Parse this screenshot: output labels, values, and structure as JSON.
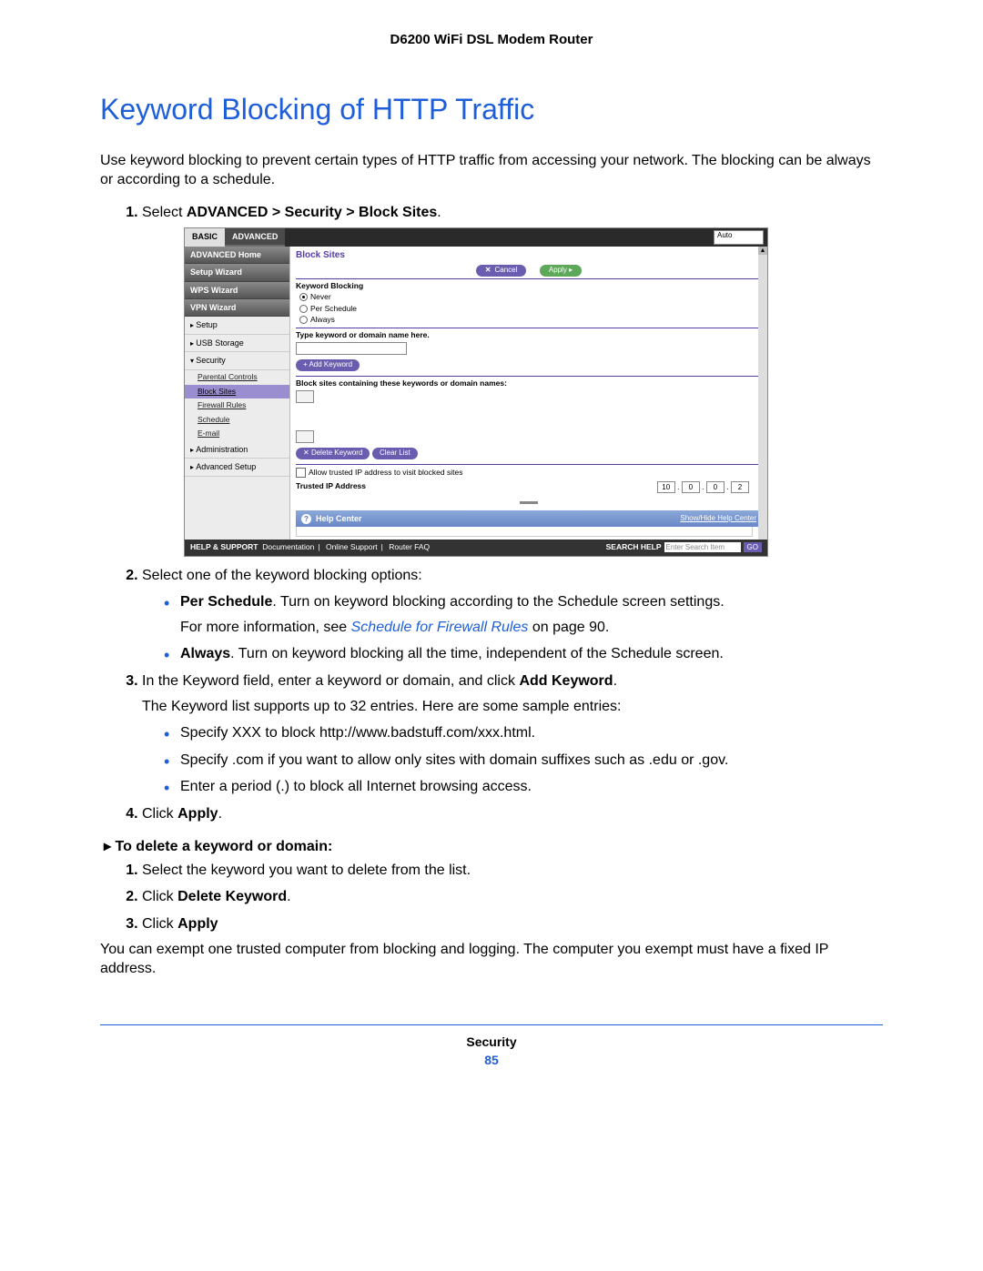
{
  "doc": {
    "header": "D6200 WiFi DSL Modem Router",
    "title": "Keyword Blocking of HTTP Traffic",
    "intro": "Use keyword blocking to prevent certain types of HTTP traffic from accessing your network. The blocking can be always or according to a schedule.",
    "step1_pre": "Select ",
    "step1_bold": "ADVANCED > Security > Block Sites",
    "step1_post": ".",
    "step2": "Select one of the keyword blocking options:",
    "opt1_label": "Per Schedule",
    "opt1_text": ". Turn on keyword blocking according to the Schedule screen settings.",
    "opt1_more_pre": "For more information, see ",
    "opt1_more_link": "Schedule for Firewall Rules",
    "opt1_more_post": " on page 90.",
    "opt2_label": "Always",
    "opt2_text": ". Turn on keyword blocking all the time, independent of the Schedule screen.",
    "step3_pre": "In the Keyword field, enter a keyword or domain, and click ",
    "step3_bold": "Add Keyword",
    "step3_post": ".",
    "step3_sub": "The Keyword list supports up to 32 entries. Here are some sample entries:",
    "samples": [
      "Specify XXX to block http://www.badstuff.com/xxx.html.",
      "Specify .com if you want to allow only sites with domain suffixes such as .edu or .gov.",
      "Enter a period (.) to block all Internet browsing access."
    ],
    "step4_pre": "Click ",
    "step4_bold": "Apply",
    "step4_post": ".",
    "proc_heading": "To delete a keyword or domain:",
    "d1": "Select the keyword you want to delete from the list.",
    "d2_pre": "Click ",
    "d2_bold": "Delete Keyword",
    "d2_post": ".",
    "d3_pre": "Click ",
    "d3_bold": "Apply",
    "exempt": "You can exempt one trusted computer from blocking and logging. The computer you exempt must have a fixed IP address.",
    "footer_label": "Security",
    "page_number": "85"
  },
  "fig": {
    "tab_basic": "BASIC",
    "tab_advanced": "ADVANCED",
    "lang": "Auto",
    "sidebar": {
      "adv_home": "ADVANCED Home",
      "setup_wiz": "Setup Wizard",
      "wps_wiz": "WPS Wizard",
      "vpn_wiz": "VPN Wizard",
      "setup": "Setup",
      "usb": "USB Storage",
      "security": "Security",
      "subs": {
        "parental": "Parental Controls",
        "block": "Block Sites",
        "firewall": "Firewall Rules",
        "schedule": "Schedule",
        "email": "E-mail"
      },
      "admin": "Administration",
      "adv_setup": "Advanced Setup"
    },
    "content": {
      "title": "Block Sites",
      "cancel": "Cancel",
      "apply": "Apply",
      "kw_label": "Keyword Blocking",
      "r_never": "Never",
      "r_sched": "Per Schedule",
      "r_always": "Always",
      "type_label": "Type keyword or domain name here.",
      "add_btn": "+ Add Keyword",
      "list_label": "Block sites containing these keywords or domain names:",
      "del_btn": "Delete Keyword",
      "clear_btn": "Clear List",
      "allow_chk": "Allow trusted IP address to visit blocked sites",
      "trusted_label": "Trusted IP Address",
      "ip": [
        "10",
        "0",
        "0",
        "2"
      ]
    },
    "help": {
      "label": "Help Center",
      "toggle": "Show/Hide Help Center"
    },
    "bottom": {
      "hs": "HELP & SUPPORT",
      "doc": "Documentation",
      "online": "Online Support",
      "faq": "Router FAQ",
      "search_label": "SEARCH HELP",
      "search_ph": "Enter Search Item",
      "go": "GO"
    }
  }
}
